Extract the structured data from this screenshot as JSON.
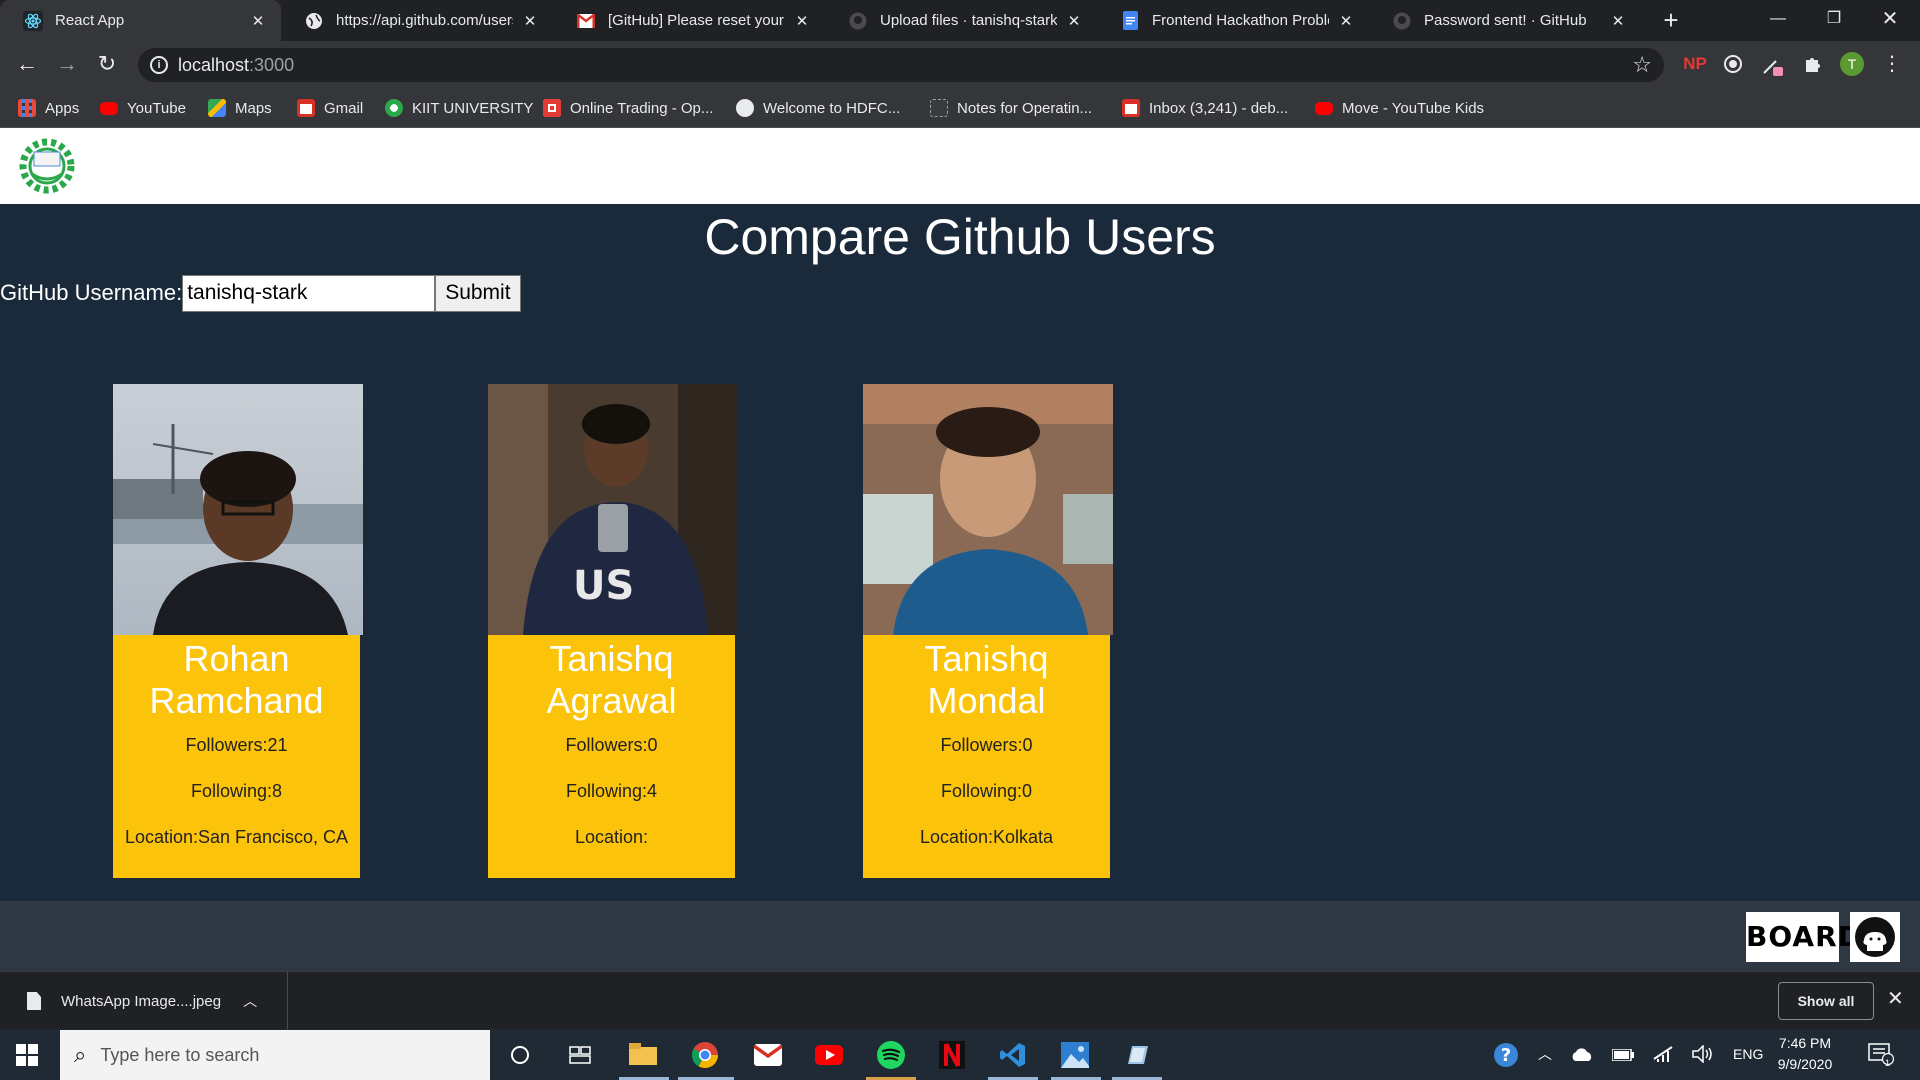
{
  "browser": {
    "tabs": [
      {
        "title": "React App",
        "active": true
      },
      {
        "title": "https://api.github.com/users/",
        "active": false
      },
      {
        "title": "[GitHub] Please reset your pa",
        "active": false
      },
      {
        "title": "Upload files · tanishq-stark/F",
        "active": false
      },
      {
        "title": "Frontend Hackathon Problem",
        "active": false
      },
      {
        "title": "Password sent! · GitHub",
        "active": false
      }
    ],
    "url_host": "localhost",
    "url_port": ":3000",
    "profile_initial": "T",
    "ext_np": "NP",
    "bookmarks": [
      "Apps",
      "YouTube",
      "Maps",
      "Gmail",
      "KIIT UNIVERSITY",
      "Online Trading - Op...",
      "Welcome to HDFC...",
      "Notes for Operatin...",
      "Inbox (3,241) - deb...",
      "Move - YouTube Kids"
    ]
  },
  "app": {
    "title": "Compare Github Users",
    "form": {
      "label": "GitHub Username:",
      "input_value": "tanishq-stark",
      "submit_label": "Submit"
    },
    "users": [
      {
        "name": "Rohan Ramchand",
        "followers": "Followers:21",
        "following": "Following:8",
        "location": "Location:San Francisco, CA"
      },
      {
        "name": "Tanishq Agrawal",
        "followers": "Followers:0",
        "following": "Following:4",
        "location": "Location:"
      },
      {
        "name": "Tanishq Mondal",
        "followers": "Followers:0",
        "following": "Following:0",
        "location": "Location:Kolkata"
      }
    ],
    "footer": {
      "board_label": "BOARD"
    }
  },
  "downloads": {
    "file_name": "WhatsApp Image....jpeg",
    "show_all_label": "Show all"
  },
  "taskbar": {
    "search_placeholder": "Type here to search",
    "language": "ENG",
    "time": "7:46 PM",
    "date": "9/9/2020",
    "notification_count": "1"
  },
  "colors": {
    "page_bg": "#1a2a3a",
    "card_info_bg": "#fcc30b",
    "footer_bg": "#2d3843"
  }
}
